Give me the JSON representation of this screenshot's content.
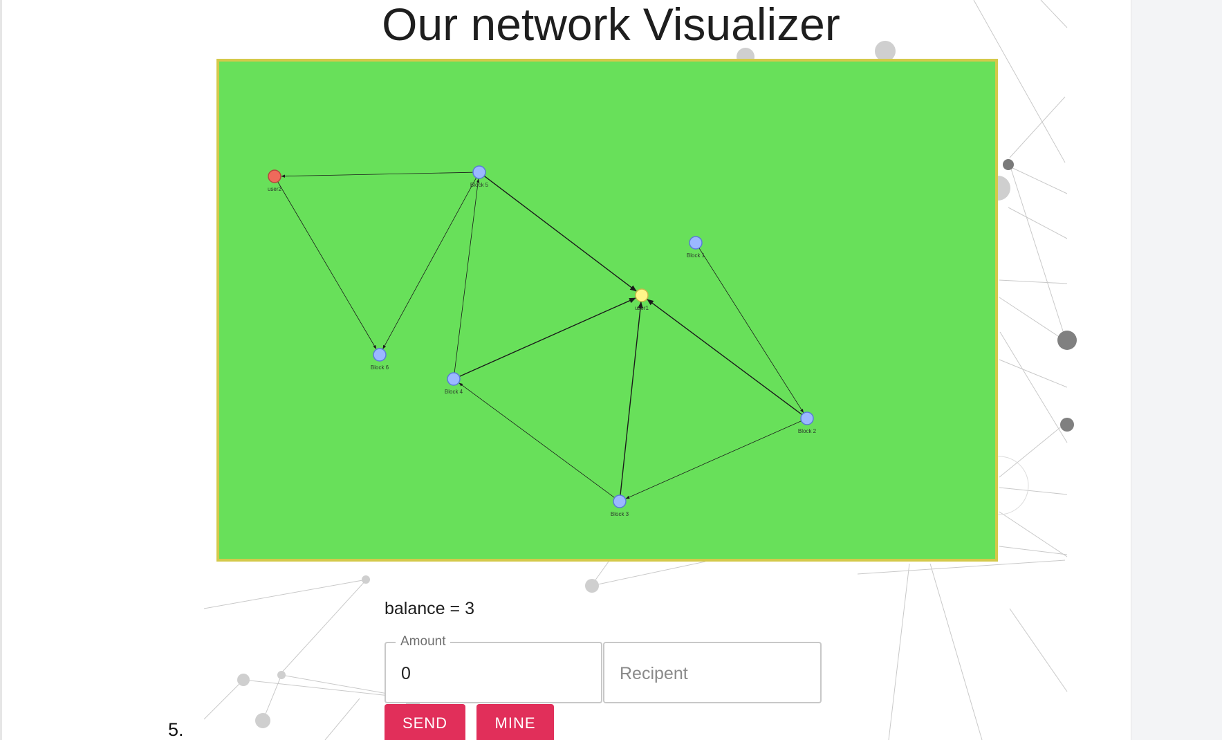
{
  "header": {
    "title": "Our network Visualizer"
  },
  "graph": {
    "panel_color": "#68e05a",
    "border_color": "#d4c94a",
    "node_color": "#9bb8ff",
    "edge_color": "#1a1a1a",
    "nodes": [
      {
        "id": "user2",
        "label": "user2",
        "color": "#ef6a5b"
      },
      {
        "id": "block5",
        "label": "Block 5",
        "color": "#9bb8ff"
      },
      {
        "id": "block1",
        "label": "Block 1",
        "color": "#9bb8ff"
      },
      {
        "id": "user1",
        "label": "user1",
        "color": "#fff68a"
      },
      {
        "id": "block6",
        "label": "Block 6",
        "color": "#9bb8ff"
      },
      {
        "id": "block4",
        "label": "Block 4",
        "color": "#9bb8ff"
      },
      {
        "id": "block2",
        "label": "Block 2",
        "color": "#9bb8ff"
      },
      {
        "id": "block3",
        "label": "Block 3",
        "color": "#9bb8ff"
      }
    ],
    "edges": [
      {
        "from": "block5",
        "to": "user2"
      },
      {
        "from": "user2",
        "to": "block6"
      },
      {
        "from": "block5",
        "to": "block6"
      },
      {
        "from": "block4",
        "to": "block5"
      },
      {
        "from": "block5",
        "to": "user1"
      },
      {
        "from": "block4",
        "to": "user1"
      },
      {
        "from": "block3",
        "to": "user1"
      },
      {
        "from": "block2",
        "to": "user1"
      },
      {
        "from": "block1",
        "to": "block2"
      },
      {
        "from": "block2",
        "to": "block3"
      },
      {
        "from": "block3",
        "to": "block4"
      }
    ]
  },
  "wallet": {
    "balance_text": "balance = 3",
    "amount": {
      "label": "Amount",
      "value": "0"
    },
    "recipient": {
      "placeholder": "Recipent"
    },
    "send_label": "SEND",
    "mine_label": "MINE"
  },
  "list_number": "5."
}
